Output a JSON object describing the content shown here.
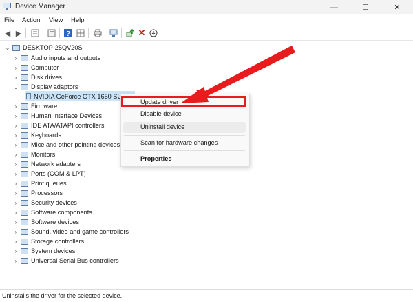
{
  "window": {
    "title": "Device Manager",
    "minimize": "—",
    "maximize": "☐",
    "close": "✕"
  },
  "menu": [
    "File",
    "Action",
    "View",
    "Help"
  ],
  "tree": {
    "root": "DESKTOP-25QV20S",
    "categories": [
      "Audio inputs and outputs",
      "Computer",
      "Disk drives",
      "Display adaptors",
      "Firmware",
      "Human Interface Devices",
      "IDE ATA/ATAPI controllers",
      "Keyboards",
      "Mice and other pointing devices",
      "Monitors",
      "Network adapters",
      "Ports (COM & LPT)",
      "Print queues",
      "Processors",
      "Security devices",
      "Software components",
      "Software devices",
      "Sound, video and game controllers",
      "Storage controllers",
      "System devices",
      "Universal Serial Bus controllers"
    ],
    "display_child": "NVIDIA GeForce GTX 1650 SUPER"
  },
  "context_menu": {
    "items": [
      "Update driver",
      "Disable device",
      "Uninstall device",
      "Scan for hardware changes",
      "Properties"
    ]
  },
  "status": "Uninstalls the driver for the selected device.",
  "colors": {
    "highlight": "#e81c1c",
    "selection": "#cce4f7"
  }
}
